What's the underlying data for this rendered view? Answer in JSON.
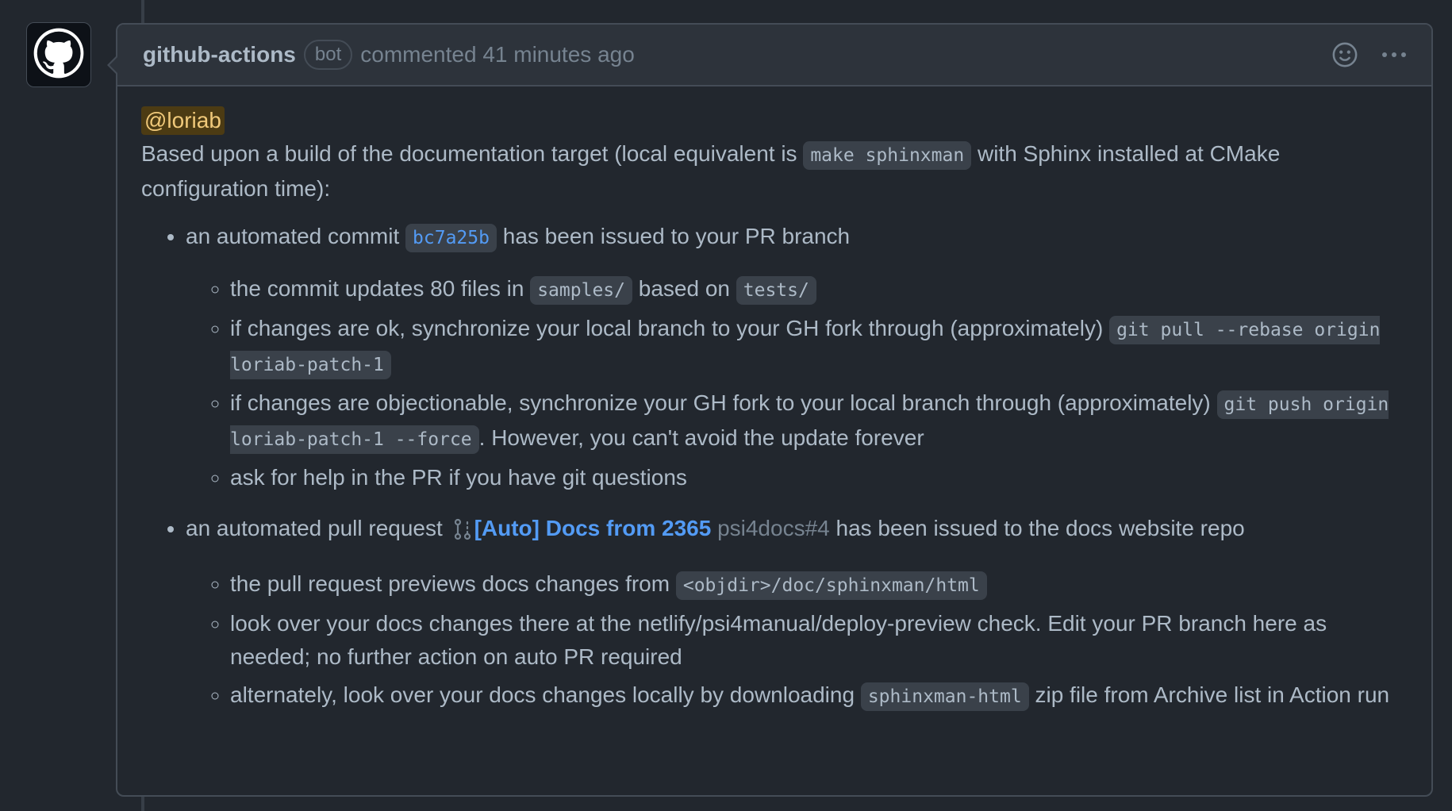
{
  "comment": {
    "author": "github-actions",
    "badge": "bot",
    "meta": "commented 41 minutes ago",
    "icons": {
      "avatar": "github-mark-icon",
      "emoji": "smiley-icon",
      "more": "kebab-horizontal-icon"
    },
    "mention": "@loriab",
    "intro_before": "Based upon a build of the documentation target (local equivalent is ",
    "intro_code": "make sphinxman",
    "intro_after": " with Sphinx installed at CMake configuration time):",
    "item1": {
      "before": "an automated commit ",
      "sha": "bc7a25b",
      "after": " has been issued to your PR branch",
      "subitems": {
        "s1_a": "the commit updates 80 files in ",
        "s1_code1": "samples/",
        "s1_b": " based on ",
        "s1_code2": "tests/",
        "s2_a": "if changes are ok, synchronize your local branch to your GH fork through (approximately) ",
        "s2_code": "git pull --rebase origin loriab-patch-1",
        "s3_a": "if changes are objectionable, synchronize your GH fork to your local branch through (approximately) ",
        "s3_code": "git push origin loriab-patch-1 --force",
        "s3_b": ". However, you can't avoid the update forever",
        "s4": "ask for help in the PR if you have git questions"
      }
    },
    "item2": {
      "before": "an automated pull request ",
      "pr_title": "[Auto] Docs from 2365",
      "pr_ref": "psi4docs#4",
      "after": " has been issued to the docs website repo",
      "pr_icon": "git-pull-request-icon",
      "subitems": {
        "s1_a": "the pull request previews docs changes from ",
        "s1_code": "<objdir>/doc/sphinxman/html",
        "s2": "look over your docs changes there at the netlify/psi4manual/deploy-preview check. Edit your PR branch here as needed; no further action on auto PR required",
        "s3_a": "alternately, look over your docs changes locally by downloading ",
        "s3_code": "sphinxman-html",
        "s3_b": " zip file from Archive list in Action run"
      }
    }
  }
}
